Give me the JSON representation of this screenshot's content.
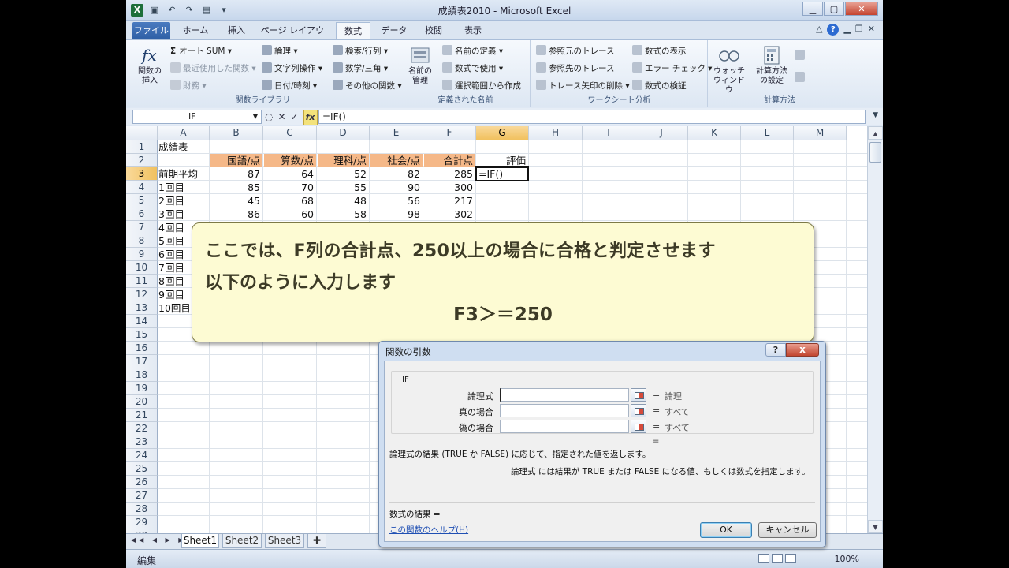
{
  "window": {
    "title": "成績表2010 - Microsoft Excel",
    "app_icon": "X"
  },
  "ribbon_tabs": [
    "ファイル",
    "ホーム",
    "挿入",
    "ページ レイアウト",
    "数式",
    "データ",
    "校閲",
    "表示"
  ],
  "ribbon": {
    "insert_function": "関数の\n挿入",
    "autosum": "オート SUM",
    "recent": "最近使用した関数",
    "financial": "財務",
    "logical": "論理",
    "text": "文字列操作",
    "datetime": "日付/時刻",
    "lookup": "検索/行列",
    "math": "数学/三角",
    "more": "その他の関数",
    "library_label": "関数ライブラリ",
    "name_manager": "名前の\n管理",
    "define_name": "名前の定義",
    "use_in_formula": "数式で使用",
    "create_from_selection": "選択範囲から作成",
    "defined_names_label": "定義された名前",
    "trace_precedents": "参照元のトレース",
    "trace_dependents": "参照先のトレース",
    "remove_arrows": "トレース矢印の削除",
    "show_formulas": "数式の表示",
    "error_checking": "エラー チェック",
    "evaluate_formula": "数式の検証",
    "watch_window": "ウォッチ\nウィンドウ",
    "audit_label": "ワークシート分析",
    "calc_options": "計算方法\nの設定",
    "calc_label": "計算方法"
  },
  "formula_bar": {
    "name_box": "IF",
    "formula": "=IF()"
  },
  "columns": [
    "A",
    "B",
    "C",
    "D",
    "E",
    "F",
    "G",
    "H",
    "I",
    "J",
    "K",
    "L",
    "M"
  ],
  "sheet": {
    "title": "成績表",
    "headers": [
      "国語/点",
      "算数/点",
      "理科/点",
      "社会/点",
      "合計点",
      "評価"
    ],
    "rows": [
      {
        "label": "前期平均",
        "values": [
          "87",
          "64",
          "52",
          "82",
          "285",
          "=IF()"
        ]
      },
      {
        "label": "1回目",
        "values": [
          "85",
          "70",
          "55",
          "90",
          "300",
          ""
        ]
      },
      {
        "label": "2回目",
        "values": [
          "45",
          "68",
          "48",
          "56",
          "217",
          ""
        ]
      },
      {
        "label": "3回目",
        "values": [
          "86",
          "60",
          "58",
          "98",
          "302",
          ""
        ]
      },
      {
        "label": "4回目",
        "values": [
          "",
          "",
          "",
          "",
          "",
          ""
        ]
      },
      {
        "label": "5回目",
        "values": [
          "",
          "",
          "",
          "",
          "",
          ""
        ]
      },
      {
        "label": "6回目",
        "values": [
          "",
          "",
          "",
          "",
          "",
          ""
        ]
      },
      {
        "label": "7回目",
        "values": [
          "",
          "",
          "",
          "",
          "",
          ""
        ]
      },
      {
        "label": "8回目",
        "values": [
          "",
          "",
          "",
          "",
          "",
          ""
        ]
      },
      {
        "label": "9回目",
        "values": [
          "",
          "",
          "",
          "",
          "",
          ""
        ]
      },
      {
        "label": "10回目",
        "values": [
          "",
          "",
          "",
          "",
          "",
          ""
        ]
      }
    ],
    "header_fill": "#f5b888"
  },
  "sheet_tabs": [
    "Sheet1",
    "Sheet2",
    "Sheet3"
  ],
  "status": {
    "mode": "編集",
    "zoom": "100%"
  },
  "callout": {
    "line1": "ここでは、F列の合計点、250以上の場合に合格と判定させます",
    "line2": "以下のように入力します",
    "line3": "F3＞＝250"
  },
  "dialog": {
    "title": "関数の引数",
    "function": "IF",
    "args": [
      {
        "label": "論理式",
        "value": "",
        "result": "論理"
      },
      {
        "label": "真の場合",
        "value": "",
        "result": "すべて"
      },
      {
        "label": "偽の場合",
        "value": "",
        "result": "すべて"
      }
    ],
    "result_eq": "=",
    "eq": "=",
    "description": "論理式の結果 (TRUE か FALSE) に応じて、指定された値を返します。",
    "arg_description": "論理式  には結果が TRUE または FALSE になる値、もしくは数式を指定します。",
    "result_line": "数式の結果 =",
    "help_link": "この関数のヘルプ(H)",
    "ok": "OK",
    "cancel": "キャンセル",
    "help_btn": "?",
    "close_btn": "x"
  }
}
